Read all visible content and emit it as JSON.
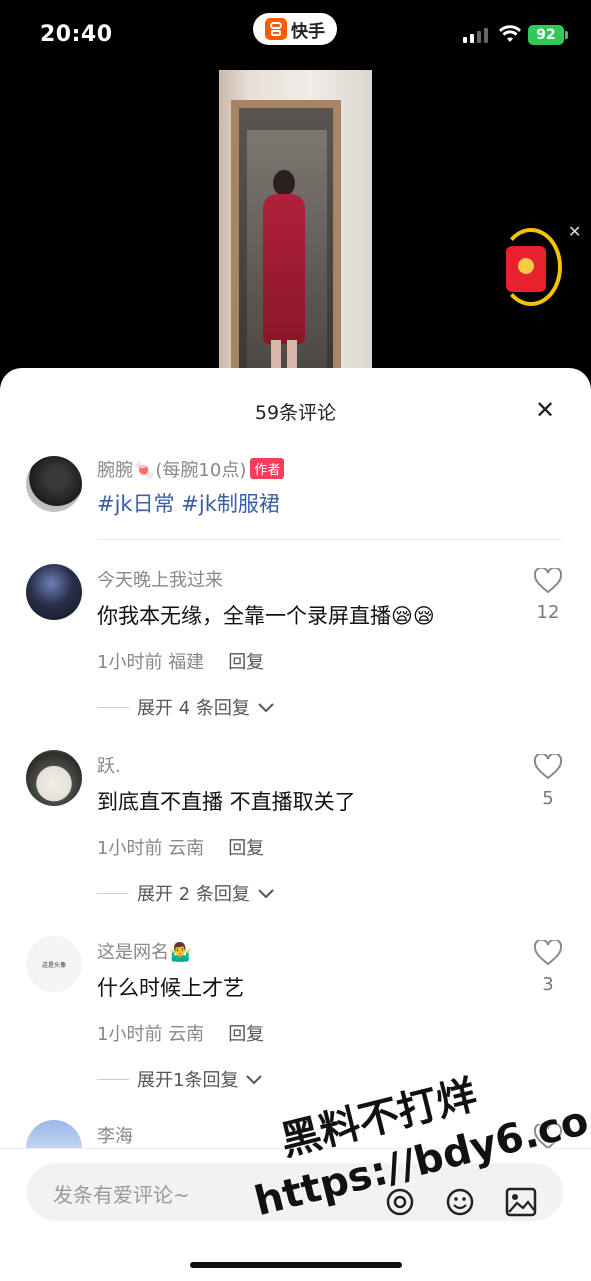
{
  "status_bar": {
    "time": "20:40",
    "app_name": "快手",
    "battery": "92"
  },
  "header": {
    "title": "59条评论",
    "close": "✕"
  },
  "author_post": {
    "name": "腕腕🍬(每腕10点)",
    "badge": "作者",
    "text": "#jk日常 #jk制服裙"
  },
  "comments": [
    {
      "name": "今天晚上我过来",
      "text": "你我本无缘，全靠一个录屏直播😪😪",
      "time": "1小时前",
      "location": "福建",
      "reply": "回复",
      "expand": "展开 4 条回复",
      "likes": "12"
    },
    {
      "name": "跃.",
      "text": "到底直不直播 不直播取关了",
      "time": "1小时前",
      "location": "云南",
      "reply": "回复",
      "expand": "展开 2 条回复",
      "likes": "5"
    },
    {
      "name": "这是网名🤷‍♂️",
      "text": "什么时候上才艺",
      "time": "1小时前",
      "location": "云南",
      "reply": "回复",
      "expand": "展开1条回复",
      "likes": "3",
      "avatar_text": "这是头像"
    },
    {
      "name": "李海"
    }
  ],
  "input": {
    "placeholder": "发条有爱评论~"
  },
  "watermark": {
    "line1": "黑料不打烊",
    "line2": "https://bdy6.co"
  },
  "colors": {
    "hashtag": "#3a5da8",
    "author_badge": "#ff3b5c",
    "battery": "#34c759",
    "redpacket": "#e8212e",
    "ring": "#f5c400"
  }
}
